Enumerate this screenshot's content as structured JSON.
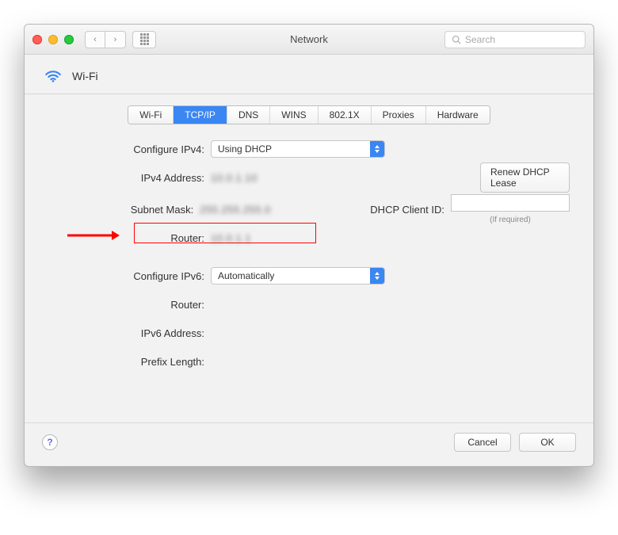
{
  "window": {
    "title": "Network"
  },
  "search": {
    "placeholder": "Search"
  },
  "header": {
    "connection_label": "Wi-Fi"
  },
  "tabs": [
    {
      "label": "Wi-Fi",
      "active": false
    },
    {
      "label": "TCP/IP",
      "active": true
    },
    {
      "label": "DNS",
      "active": false
    },
    {
      "label": "WINS",
      "active": false
    },
    {
      "label": "802.1X",
      "active": false
    },
    {
      "label": "Proxies",
      "active": false
    },
    {
      "label": "Hardware",
      "active": false
    }
  ],
  "ipv4": {
    "configure_label": "Configure IPv4:",
    "configure_value": "Using DHCP",
    "address_label": "IPv4 Address:",
    "address_value": "10.0.1.10",
    "subnet_label": "Subnet Mask:",
    "subnet_value": "255.255.255.0",
    "router_label": "Router:",
    "router_value": "10.0.1.1",
    "renew_button": "Renew DHCP Lease",
    "dhcp_client_id_label": "DHCP Client ID:",
    "dhcp_client_id_value": "",
    "if_required": "(If required)"
  },
  "ipv6": {
    "configure_label": "Configure IPv6:",
    "configure_value": "Automatically",
    "router_label": "Router:",
    "router_value": "",
    "address_label": "IPv6 Address:",
    "address_value": "",
    "prefix_label": "Prefix Length:",
    "prefix_value": ""
  },
  "footer": {
    "help_glyph": "?",
    "cancel": "Cancel",
    "ok": "OK"
  },
  "icons": {
    "back": "‹",
    "forward": "›"
  }
}
